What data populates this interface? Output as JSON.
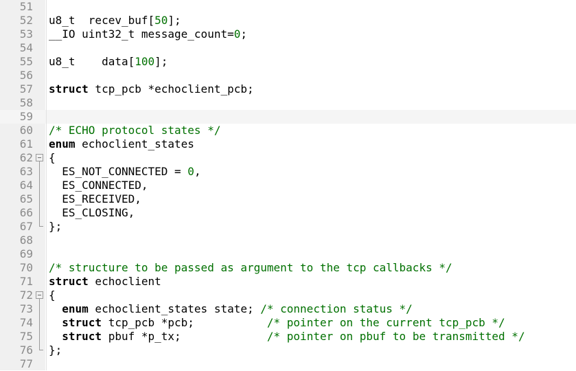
{
  "editor": {
    "language": "C",
    "first_line": 51,
    "last_line": 77,
    "current_line": 59,
    "colors": {
      "background": "#ffffff",
      "gutter_background": "#f0f0f0",
      "line_number": "#8a8a8a",
      "current_line_highlight": "#f5f5f5",
      "keyword": "#000000",
      "comment": "#007000",
      "number": "#007000",
      "text": "#000000",
      "fold_marker": "#9a9a9a"
    },
    "lines": [
      {
        "number": "51",
        "fold": "none",
        "current": false,
        "tokens": []
      },
      {
        "number": "52",
        "fold": "none",
        "current": false,
        "tokens": [
          {
            "t": "u8_t  recev_buf[",
            "k": "plain"
          },
          {
            "t": "50",
            "k": "num"
          },
          {
            "t": "];",
            "k": "plain"
          }
        ]
      },
      {
        "number": "53",
        "fold": "none",
        "current": false,
        "tokens": [
          {
            "t": "__IO uint32_t message_count=",
            "k": "plain"
          },
          {
            "t": "0",
            "k": "num"
          },
          {
            "t": ";",
            "k": "plain"
          }
        ]
      },
      {
        "number": "54",
        "fold": "none",
        "current": false,
        "tokens": []
      },
      {
        "number": "55",
        "fold": "none",
        "current": false,
        "tokens": [
          {
            "t": "u8_t    data[",
            "k": "plain"
          },
          {
            "t": "100",
            "k": "num"
          },
          {
            "t": "];",
            "k": "plain"
          }
        ]
      },
      {
        "number": "56",
        "fold": "none",
        "current": false,
        "tokens": []
      },
      {
        "number": "57",
        "fold": "none",
        "current": false,
        "tokens": [
          {
            "t": "struct",
            "k": "kw"
          },
          {
            "t": " tcp_pcb *echoclient_pcb;",
            "k": "plain"
          }
        ]
      },
      {
        "number": "58",
        "fold": "none",
        "current": false,
        "tokens": []
      },
      {
        "number": "59",
        "fold": "none",
        "current": true,
        "tokens": []
      },
      {
        "number": "60",
        "fold": "none",
        "current": false,
        "tokens": [
          {
            "t": "/* ECHO protocol states */",
            "k": "comment"
          }
        ]
      },
      {
        "number": "61",
        "fold": "none",
        "current": false,
        "tokens": [
          {
            "t": "enum",
            "k": "kw"
          },
          {
            "t": " echoclient_states",
            "k": "plain"
          }
        ]
      },
      {
        "number": "62",
        "fold": "start",
        "current": false,
        "tokens": [
          {
            "t": "{",
            "k": "plain"
          }
        ]
      },
      {
        "number": "63",
        "fold": "rail",
        "current": false,
        "tokens": [
          {
            "t": "  ES_NOT_CONNECTED = ",
            "k": "plain"
          },
          {
            "t": "0",
            "k": "num"
          },
          {
            "t": ",",
            "k": "plain"
          }
        ]
      },
      {
        "number": "64",
        "fold": "rail",
        "current": false,
        "tokens": [
          {
            "t": "  ES_CONNECTED,",
            "k": "plain"
          }
        ]
      },
      {
        "number": "65",
        "fold": "rail",
        "current": false,
        "tokens": [
          {
            "t": "  ES_RECEIVED,",
            "k": "plain"
          }
        ]
      },
      {
        "number": "66",
        "fold": "rail",
        "current": false,
        "tokens": [
          {
            "t": "  ES_CLOSING,",
            "k": "plain"
          }
        ]
      },
      {
        "number": "67",
        "fold": "end",
        "current": false,
        "tokens": [
          {
            "t": "};",
            "k": "plain"
          }
        ]
      },
      {
        "number": "68",
        "fold": "none",
        "current": false,
        "tokens": []
      },
      {
        "number": "69",
        "fold": "none",
        "current": false,
        "tokens": []
      },
      {
        "number": "70",
        "fold": "none",
        "current": false,
        "tokens": [
          {
            "t": "/* structure to be passed as argument to the tcp callbacks */",
            "k": "comment"
          }
        ]
      },
      {
        "number": "71",
        "fold": "none",
        "current": false,
        "tokens": [
          {
            "t": "struct",
            "k": "kw"
          },
          {
            "t": " echoclient",
            "k": "plain"
          }
        ]
      },
      {
        "number": "72",
        "fold": "start",
        "current": false,
        "tokens": [
          {
            "t": "{",
            "k": "plain"
          }
        ]
      },
      {
        "number": "73",
        "fold": "rail",
        "current": false,
        "tokens": [
          {
            "t": "  ",
            "k": "plain"
          },
          {
            "t": "enum",
            "k": "kw"
          },
          {
            "t": " echoclient_states state; ",
            "k": "plain"
          },
          {
            "t": "/* connection status */",
            "k": "comment"
          }
        ]
      },
      {
        "number": "74",
        "fold": "rail",
        "current": false,
        "tokens": [
          {
            "t": "  ",
            "k": "plain"
          },
          {
            "t": "struct",
            "k": "kw"
          },
          {
            "t": " tcp_pcb *pcb;           ",
            "k": "plain"
          },
          {
            "t": "/* pointer on the current tcp_pcb */",
            "k": "comment"
          }
        ]
      },
      {
        "number": "75",
        "fold": "rail",
        "current": false,
        "tokens": [
          {
            "t": "  ",
            "k": "plain"
          },
          {
            "t": "struct",
            "k": "kw"
          },
          {
            "t": " pbuf *p_tx;             ",
            "k": "plain"
          },
          {
            "t": "/* pointer on pbuf to be transmitted */",
            "k": "comment"
          }
        ]
      },
      {
        "number": "76",
        "fold": "end",
        "current": false,
        "tokens": [
          {
            "t": "};",
            "k": "plain"
          }
        ]
      },
      {
        "number": "77",
        "fold": "none",
        "current": false,
        "tokens": []
      }
    ]
  }
}
